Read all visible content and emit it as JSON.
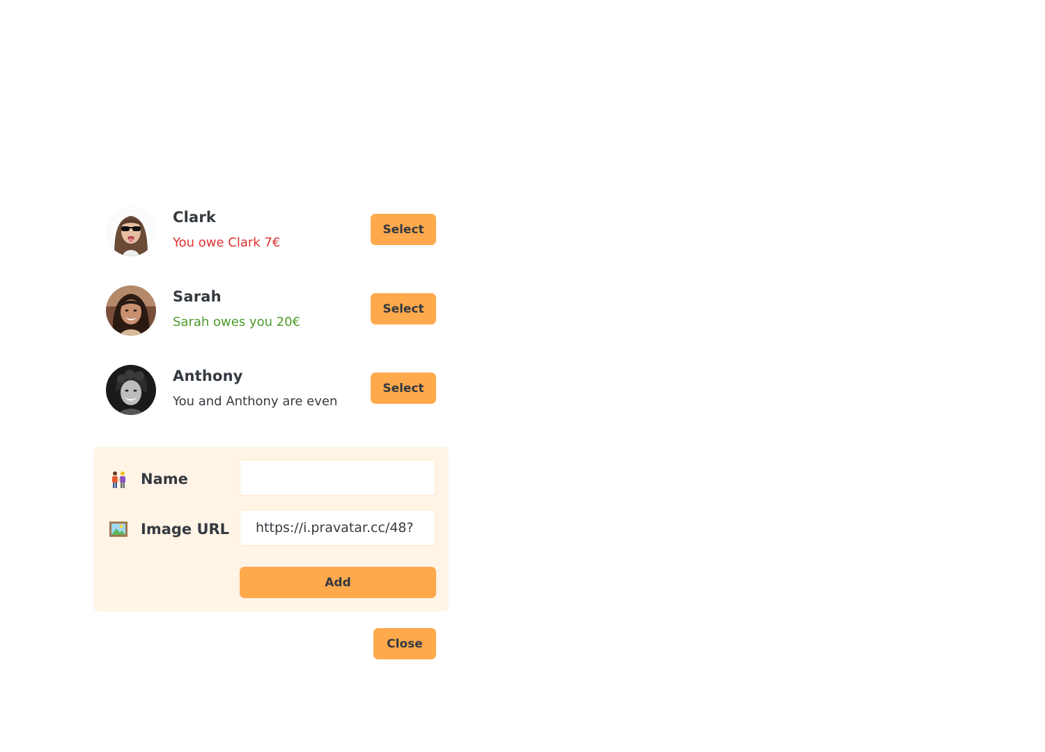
{
  "friends": [
    {
      "name": "Clark",
      "balance": "You owe Clark 7€",
      "balance_status": "negative",
      "balance_color": "#e03131",
      "select_label": "Select",
      "avatar": "clark-avatar"
    },
    {
      "name": "Sarah",
      "balance": "Sarah owes you 20€",
      "balance_status": "positive",
      "balance_color": "#4c9a2a",
      "select_label": "Select",
      "avatar": "sarah-avatar"
    },
    {
      "name": "Anthony",
      "balance": "You and Anthony are even",
      "balance_status": "even",
      "balance_color": "#343a40",
      "select_label": "Select",
      "avatar": "anthony-avatar"
    }
  ],
  "form": {
    "name_icon": "people-holding-hands-icon",
    "name_label": "Name",
    "name_value": "",
    "image_icon": "framed-picture-icon",
    "image_label": "Image URL",
    "image_value": "https://i.pravatar.cc/48?",
    "add_label": "Add"
  },
  "close_label": "Close",
  "colors": {
    "accent": "#ffa94d",
    "form_background": "#fff4e6",
    "text": "#343a40",
    "negative": "#e03131",
    "positive": "#4c9a2a"
  }
}
